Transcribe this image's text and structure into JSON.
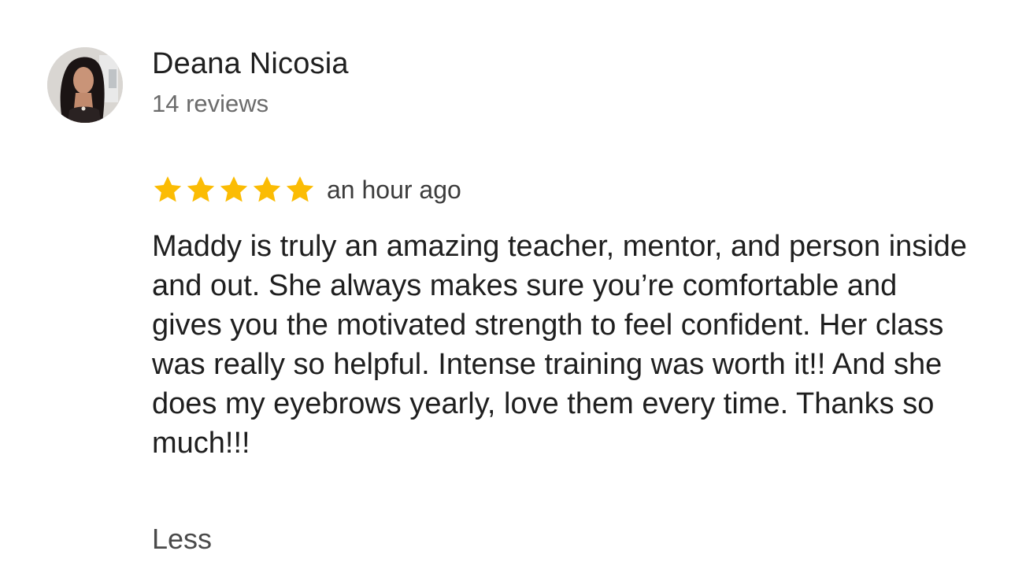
{
  "review": {
    "reviewer_name": "Deana Nicosia",
    "review_count": "14 reviews",
    "rating": 5,
    "rating_max": 5,
    "time_ago": "an hour ago",
    "text": "Maddy is truly an amazing teacher, mentor, and person inside and out. She always makes sure you’re comfortable and gives you the motivated strength to feel confident. Her class was really so helpful. Intense training was worth it!! And she does my eyebrows yearly, love them every time. Thanks so much!!!",
    "less_label": "Less"
  },
  "colors": {
    "star": "#fbbc04",
    "name": "#1f1f1f",
    "secondary_text": "#6b6b6b",
    "background": "#ffffff"
  },
  "icons": {
    "avatar": "reviewer-avatar-photo",
    "star": "star-icon"
  }
}
